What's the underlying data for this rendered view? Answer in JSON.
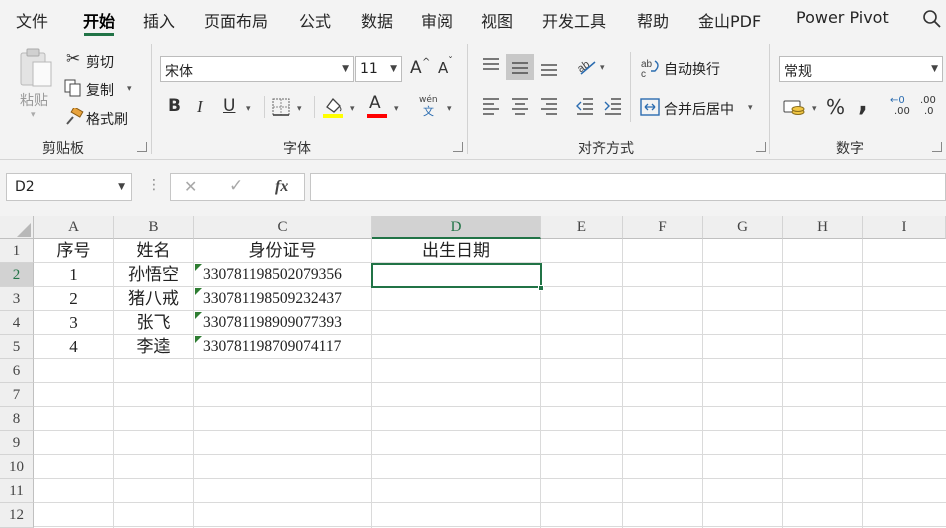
{
  "menu": {
    "tabs": [
      "文件",
      "开始",
      "插入",
      "页面布局",
      "公式",
      "数据",
      "审阅",
      "视图",
      "开发工具",
      "帮助",
      "金山PDF",
      "Power Pivot"
    ],
    "active_index": 1
  },
  "ribbon": {
    "clipboard": {
      "paste": "粘贴",
      "cut": "剪切",
      "copy": "复制",
      "format_painter": "格式刷",
      "label": "剪贴板"
    },
    "font": {
      "name": "宋体",
      "size": "11",
      "bold": "B",
      "italic": "I",
      "underline": "U",
      "grow": "A",
      "shrink": "A",
      "font_color_letter": "A",
      "wen_top": "wén",
      "wen_bottom": "文",
      "label": "字体"
    },
    "alignment": {
      "wrap_text": "自动换行",
      "merge_center": "合并后居中",
      "label": "对齐方式"
    },
    "number": {
      "format": "常规",
      "percent": "%",
      "comma": ",",
      "inc_top": "←0",
      "inc_bottom": ".00",
      "dec_top": ".00",
      "dec_bottom": ".0",
      "label": "数字"
    },
    "colors": {
      "accent": "#217346",
      "highlight": "#ffff00",
      "font_color": "#ff0000"
    }
  },
  "formula_bar": {
    "name_box": "D2",
    "cancel": "✕",
    "enter": "✓",
    "fx": "fx",
    "value": ""
  },
  "sheet": {
    "columns": [
      "A",
      "B",
      "C",
      "D",
      "E",
      "F",
      "G",
      "H",
      "I"
    ],
    "rows": [
      "1",
      "2",
      "3",
      "4",
      "5",
      "6",
      "7",
      "8",
      "9",
      "10",
      "11",
      "12"
    ],
    "selected_cell": "D2",
    "header": {
      "A": "序号",
      "B": "姓名",
      "C": "身份证号",
      "D": "出生日期"
    },
    "data": [
      {
        "A": "1",
        "B": "孙悟空",
        "C": "330781198502079356",
        "D": ""
      },
      {
        "A": "2",
        "B": "猪八戒",
        "C": "330781198509232437",
        "D": ""
      },
      {
        "A": "3",
        "B": "张飞",
        "C": "330781198909077393",
        "D": ""
      },
      {
        "A": "4",
        "B": "李逵",
        "C": "330781198709074117",
        "D": ""
      }
    ]
  }
}
